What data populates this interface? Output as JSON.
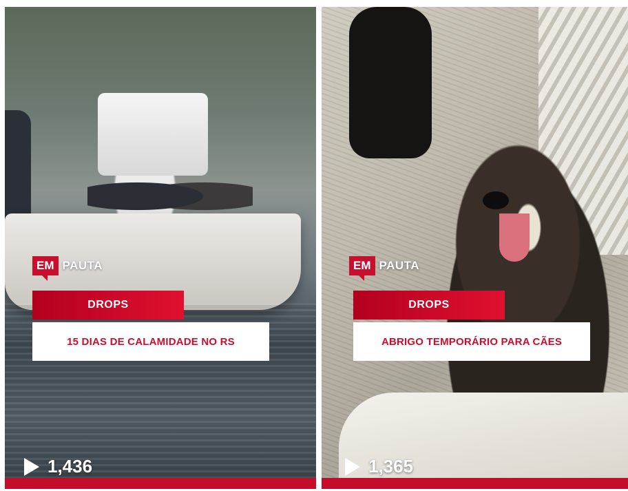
{
  "cards": [
    {
      "brand_mark": "EM",
      "brand_text": "PAUTA",
      "category": "DROPS",
      "headline": "15 DIAS DE CALAMIDADE NO RS",
      "views": "1,436"
    },
    {
      "brand_mark": "EM",
      "brand_text": "PAUTA",
      "category": "DROPS",
      "headline": "ABRIGO TEMPORÁRIO PARA CÃES",
      "views": "1,365"
    }
  ],
  "colors": {
    "brand_red": "#c8102e",
    "white": "#ffffff"
  },
  "icons": [
    "play-icon"
  ]
}
